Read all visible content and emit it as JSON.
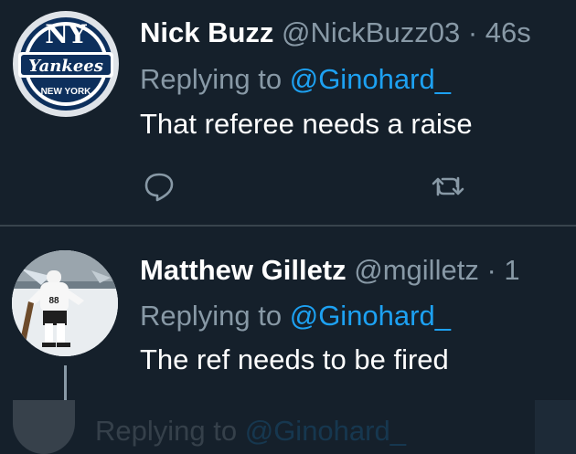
{
  "tweets": [
    {
      "name": "Nick Buzz",
      "handle": "@NickBuzz03",
      "separator": "·",
      "time": "46s",
      "reply_prefix": "Replying to",
      "reply_mention": "@Ginohard_",
      "text": "That referee needs a raise",
      "avatar": "yankees-logo",
      "avatar_text_top": "NY",
      "avatar_text_middle": "Yankees",
      "avatar_text_bottom": "NEW YORK"
    },
    {
      "name": "Matthew Gilletz",
      "handle": "@mgilletz",
      "separator": "·",
      "time": "1",
      "reply_prefix": "Replying to",
      "reply_mention": "@Ginohard_",
      "text": "The ref needs to be fired",
      "avatar": "hockey-player-photo",
      "jersey_number": "88"
    }
  ],
  "faded_tweet": {
    "reply_prefix": "Replying to",
    "reply_mention": "@Ginohard_"
  },
  "icons": {
    "reply": "reply-icon",
    "retweet": "retweet-icon"
  },
  "colors": {
    "background": "#15202b",
    "text": "#ffffff",
    "secondary": "#8899a6",
    "accent": "#1da1f2",
    "divider": "#38444d"
  }
}
